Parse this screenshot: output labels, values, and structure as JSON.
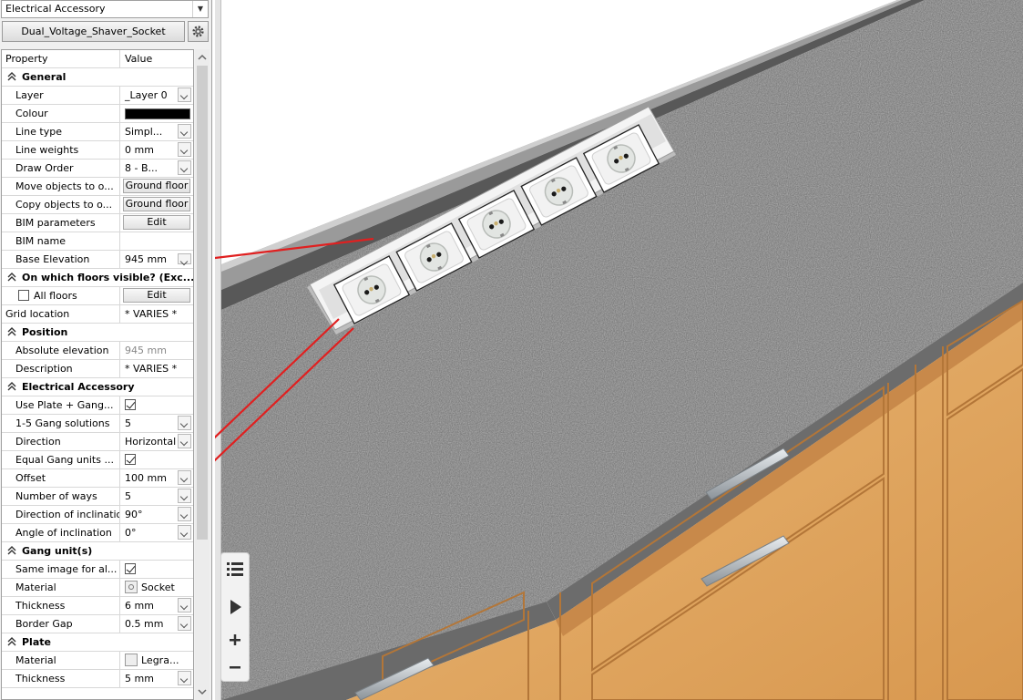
{
  "panel": {
    "category": "Electrical Accessory",
    "object_name": "Dual_Voltage_Shaver_Socket",
    "header": {
      "property": "Property",
      "value": "Value"
    },
    "rows": [
      {
        "type": "section",
        "label": "General"
      },
      {
        "type": "dropdown",
        "label": "Layer",
        "value": "_Layer 0"
      },
      {
        "type": "colour",
        "label": "Colour",
        "color": "#000000"
      },
      {
        "type": "dropdown",
        "label": "Line type",
        "value": "Simpl..."
      },
      {
        "type": "dropdown",
        "label": "Line weights",
        "value": "0 mm"
      },
      {
        "type": "dropdown",
        "label": "Draw Order",
        "value": "8 - B..."
      },
      {
        "type": "button",
        "label": "Move objects to o...",
        "value": "Ground floor"
      },
      {
        "type": "button",
        "label": "Copy objects to o...",
        "value": "Ground floor"
      },
      {
        "type": "button",
        "label": "BIM parameters",
        "value": "Edit"
      },
      {
        "type": "text",
        "label": "BIM name",
        "value": ""
      },
      {
        "type": "spin",
        "label": "Base Elevation",
        "value": "945 mm"
      },
      {
        "type": "section",
        "label": "On which floors visible? (Exc..."
      },
      {
        "type": "checkbutton",
        "label": "All floors",
        "value": "Edit"
      },
      {
        "type": "text-flush",
        "label": "Grid location",
        "value": "* VARIES *"
      },
      {
        "type": "section",
        "label": "Position"
      },
      {
        "type": "readonly",
        "label": "Absolute elevation",
        "value": "945 mm"
      },
      {
        "type": "text",
        "label": "Description",
        "value": "* VARIES *"
      },
      {
        "type": "section",
        "label": "Electrical Accessory"
      },
      {
        "type": "check",
        "label": "Use Plate + Gang...",
        "checked": true
      },
      {
        "type": "dropdown",
        "label": "1-5 Gang solutions",
        "value": "5"
      },
      {
        "type": "dropdown",
        "label": "Direction",
        "value": "Horizontal"
      },
      {
        "type": "check",
        "label": "Equal Gang units ...",
        "checked": true
      },
      {
        "type": "dropdown",
        "label": "Offset",
        "value": "100 mm"
      },
      {
        "type": "dropdown",
        "label": "Number of ways",
        "value": "5"
      },
      {
        "type": "dropdown",
        "label": "Direction of inclination",
        "value": "90°"
      },
      {
        "type": "dropdown",
        "label": "Angle of inclination",
        "value": "0°"
      },
      {
        "type": "section",
        "label": "Gang unit(s)"
      },
      {
        "type": "check",
        "label": "Same image for al...",
        "checked": true
      },
      {
        "type": "material",
        "label": "Material",
        "value": "Socket",
        "icon": "socket"
      },
      {
        "type": "dropdown",
        "label": "Thickness",
        "value": "6 mm"
      },
      {
        "type": "dropdown",
        "label": "Border Gap",
        "value": "0.5 mm"
      },
      {
        "type": "section",
        "label": "Plate"
      },
      {
        "type": "material",
        "label": "Material",
        "value": "Legra...",
        "icon": "blank"
      },
      {
        "type": "dropdown",
        "label": "Thickness",
        "value": "5 mm"
      }
    ]
  },
  "viewport": {
    "socket_count": 5,
    "colors": {
      "worktop": "#7c7c7c",
      "worktop_edge": "#5a5a5a",
      "wall": "#ffffff",
      "cabinet": "#e2a865",
      "cabinet_dark": "#c98a45",
      "arrow": "#e02020"
    }
  }
}
